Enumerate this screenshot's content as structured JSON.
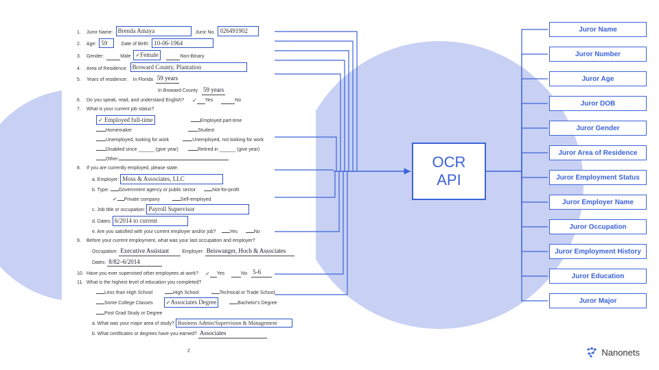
{
  "accent": "#3a62d8",
  "ocr_box": {
    "line1": "OCR",
    "line2": "API"
  },
  "brand": "Nanonets",
  "form": {
    "q1": {
      "num": "1.",
      "label": "Juror Name:",
      "name": "Brenda Amaya",
      "jn_label": "Juror No.",
      "juror_no": "026491902"
    },
    "q2": {
      "num": "2.",
      "label": "Age:",
      "age": "59",
      "dob_label": "Date of Birth:",
      "dob": "10-06-1964"
    },
    "q3": {
      "num": "3.",
      "label": "Gender:",
      "male": "Male",
      "female": "Female",
      "nonbinary": "Non-Binary"
    },
    "q4": {
      "num": "4.",
      "label": "Area of Residence:",
      "val": "Broward County, Plantation"
    },
    "q5": {
      "num": "5.",
      "label": "Years of residence:",
      "fl": "In Florida",
      "flv": "59 years",
      "bc": "In Broward County",
      "bcv": "59 years"
    },
    "q6": {
      "num": "6.",
      "label": "Do you speak, read, and understand English?",
      "yes": "Yes",
      "no": "No"
    },
    "q7": {
      "num": "7.",
      "label": "What is your current job status?",
      "o1": "Employed full-time",
      "o2": "Employed part-time",
      "o3": "Homemaker",
      "o4": "Student",
      "o5": "Unemployed, looking for work",
      "o6": "Unemployed, not looking for work",
      "o7": "Disabled since ______ (give year)",
      "o8": "Retired in ______ (give year)",
      "o9": "Other:"
    },
    "q8": {
      "num": "8.",
      "label": "If you are currently employed, please state:",
      "a": "a.  Employer:",
      "av": "Moss & Associates, LLC",
      "b": "b.  Type:",
      "b1": "Government agency or public sector",
      "b2": "Not-for-profit",
      "b3": "Private company",
      "b4": "Self-employed",
      "c": "c.  Job title or occupation:",
      "cv": "Payroll Supervisor",
      "d": "d.  Dates:",
      "dv": "6/2014 to current",
      "e": "e.  Are you satisfied with your current employer and/or job?",
      "yes": "Yes",
      "no": "No"
    },
    "q9": {
      "num": "9.",
      "label": "Before your current employment, what was your last occupation and employer?",
      "occ_l": "Occupation:",
      "occ": "Executive Assistant",
      "emp_l": "Employer:",
      "emp": "Beiswanger, Hoch & Associates",
      "dates_l": "Dates:",
      "dates": "8/82–6/2014"
    },
    "q10": {
      "num": "10.",
      "label": "Have you ever supervised other employees at work?",
      "yes": "Yes",
      "no": "No",
      "count": "5-6"
    },
    "q11": {
      "num": "11.",
      "label": "What is the highest level of education you completed?",
      "o1": "Less than High School",
      "o2": "High School",
      "o3": "Technical or Trade School",
      "o4": "Some College Classes",
      "o5": "Associates Degree",
      "o6": "Bachelor's Degree",
      "o7": "Post Grad Study or Degree",
      "a": "a.  What was your major area of study?",
      "av": "Business Admin/Supervision & Management",
      "b": "b.  What certificates or degrees have you earned?",
      "bv": "Associates"
    },
    "page": "2"
  },
  "fields": [
    "Juror Name",
    "Juror Number",
    "Juror Age",
    "Juror DOB",
    "Juror Gender",
    "Juror Area of Residence",
    "Juror Employment Status",
    "Juror Employer Name",
    "Juror Occupation",
    "Juror Employment History",
    "Juror Education",
    "Juror Major"
  ]
}
